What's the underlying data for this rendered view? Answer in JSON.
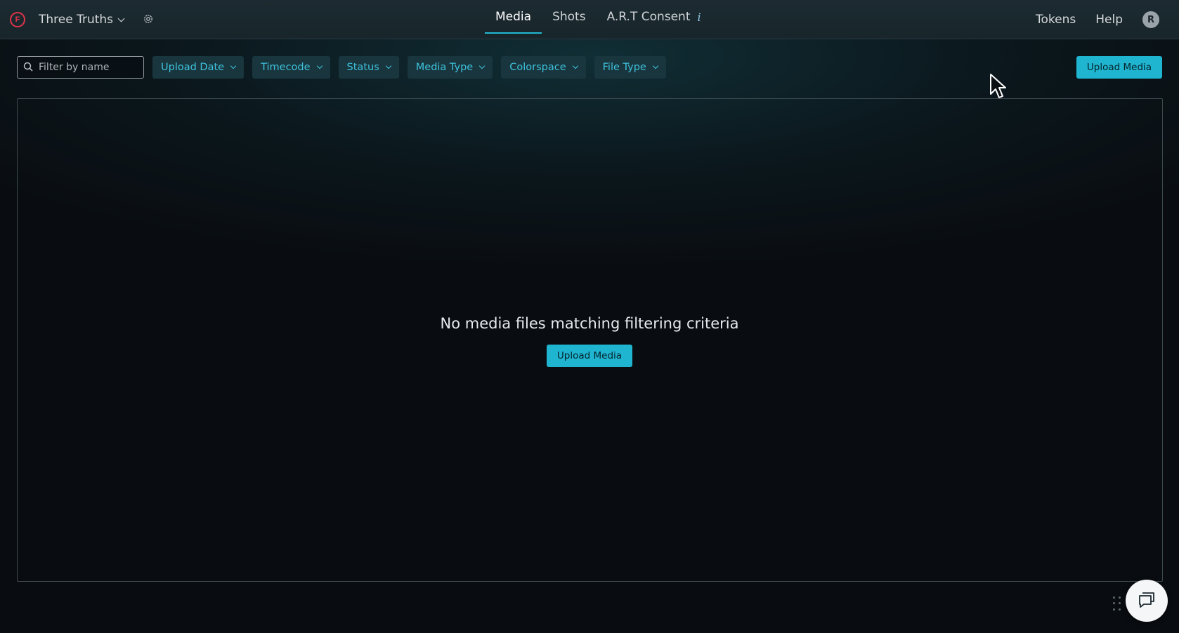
{
  "topbar": {
    "logo_letter": "F",
    "project_name": "Three Truths",
    "tabs": [
      {
        "label": "Media",
        "active": true
      },
      {
        "label": "Shots",
        "active": false
      },
      {
        "label": "A.R.T Consent",
        "active": false
      }
    ],
    "info_glyph": "i",
    "tokens_label": "Tokens",
    "help_label": "Help",
    "avatar_initial": "R"
  },
  "filters": {
    "search_placeholder": "Filter by name",
    "search_value": "",
    "items": [
      {
        "label": "Upload Date"
      },
      {
        "label": "Timecode"
      },
      {
        "label": "Status"
      },
      {
        "label": "Media Type"
      },
      {
        "label": "Colorspace"
      },
      {
        "label": "File Type"
      }
    ],
    "upload_label": "Upload Media"
  },
  "main": {
    "empty_message": "No media files matching filtering criteria",
    "upload_label": "Upload Media"
  },
  "colors": {
    "accent": "#1fb5d0",
    "filter_bg": "#19353d",
    "filter_text": "#3ec3de",
    "logo": "#e0334a"
  },
  "icons": {
    "logo": "brand-logo-icon",
    "gear": "gear-icon",
    "search": "search-icon",
    "chat": "chat-icon",
    "drag": "drag-handle-icon"
  }
}
